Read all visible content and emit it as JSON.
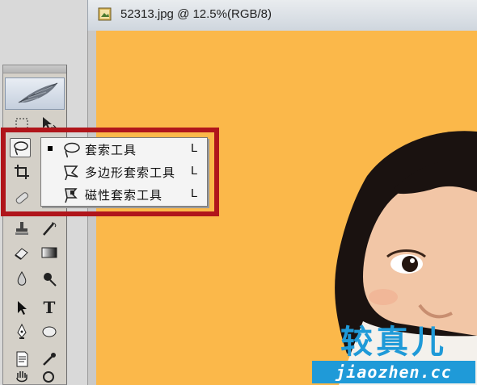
{
  "document": {
    "title": "52313.jpg @ 12.5%(RGB/8)",
    "icon": "photoshop-doc-icon",
    "zoom": "12.5%",
    "canvas_color": "#fbb84a"
  },
  "toolbox": {
    "tools": [
      {
        "name": "marquee-tool",
        "icon": "marquee-icon"
      },
      {
        "name": "move-tool",
        "icon": "move-icon"
      },
      {
        "name": "lasso-tool",
        "icon": "lasso-icon",
        "active": true
      },
      {
        "name": "crop-tool",
        "icon": "crop-icon"
      },
      {
        "name": "healing-brush-tool",
        "icon": "bandage-icon"
      },
      {
        "name": "clone-stamp-tool",
        "icon": "stamp-icon"
      },
      {
        "name": "history-brush-tool",
        "icon": "history-brush-icon"
      },
      {
        "name": "eraser-tool",
        "icon": "eraser-icon"
      },
      {
        "name": "gradient-tool",
        "icon": "gradient-icon"
      },
      {
        "name": "blur-tool",
        "icon": "drop-icon"
      },
      {
        "name": "burn-tool",
        "icon": "burn-icon"
      },
      {
        "name": "path-selection-tool",
        "icon": "arrow-icon"
      },
      {
        "name": "type-tool",
        "icon": "type-icon",
        "glyph": "T"
      },
      {
        "name": "pen-tool",
        "icon": "pen-icon"
      },
      {
        "name": "shape-tool",
        "icon": "ellipse-icon"
      },
      {
        "name": "notes-tool",
        "icon": "notes-icon"
      },
      {
        "name": "eyedropper-tool",
        "icon": "eyedropper-icon"
      },
      {
        "name": "hand-tool",
        "icon": "hand-icon"
      },
      {
        "name": "zoom-tool",
        "icon": "zoom-icon"
      }
    ]
  },
  "flyout": {
    "accent_color": "#b0151b",
    "items": [
      {
        "label": "套索工具",
        "shortcut": "L",
        "selected": true,
        "icon": "lasso-icon"
      },
      {
        "label": "多边形套索工具",
        "shortcut": "L",
        "selected": false,
        "icon": "polygonal-lasso-icon"
      },
      {
        "label": "磁性套索工具",
        "shortcut": "L",
        "selected": false,
        "icon": "magnetic-lasso-icon"
      }
    ]
  },
  "watermark": {
    "title": "较真儿",
    "url": "jiaozhen.cc",
    "color": "#1f9ad8"
  }
}
